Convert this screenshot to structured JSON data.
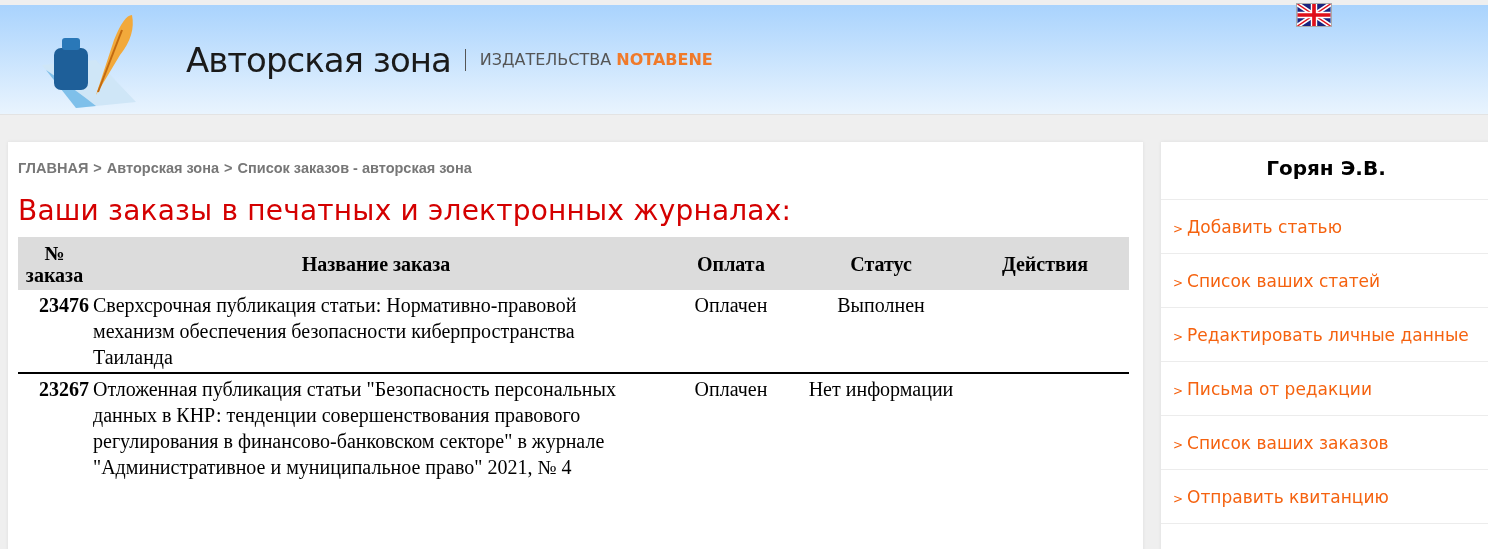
{
  "header": {
    "logo_title": "Авторская зона",
    "logo_subtitle": "ИЗДАТЕЛЬСТВА",
    "logo_brand": "NOTABENE"
  },
  "breadcrumb": [
    {
      "label": "ГЛАВНАЯ"
    },
    {
      "label": "Авторская зона"
    },
    {
      "label": "Список заказов - авторская зона"
    }
  ],
  "breadcrumb_separator": ">",
  "page_title": "Ваши заказы в печатных и электронных журналах:",
  "table": {
    "columns": [
      "№ заказа",
      "Название заказа",
      "Оплата",
      "Статус",
      "Действия"
    ],
    "rows": [
      {
        "number": "23476",
        "title": "Сверхсрочная публикация статьи: Нормативно-правовой механизм обеспечения безопасности киберпространства Таиланда",
        "payment": "Оплачен",
        "status": "Выполнен"
      },
      {
        "number": "23267",
        "title": "Отложенная публикация статьи \"Безопасность персональных данных в КНР: тенденции совершенствования правового регулирования в финансово-банковском секторе\" в журнале \"Административное и муниципальное право\" 2021, № 4",
        "payment": "Оплачен",
        "status": "Нет информации"
      }
    ]
  },
  "sidebar": {
    "user_name": "Горян Э.В.",
    "marker": ">",
    "items": [
      {
        "label": "Добавить статью"
      },
      {
        "label": "Список ваших статей"
      },
      {
        "label": "Редактировать личные данные"
      },
      {
        "label": "Письма от редакции"
      },
      {
        "label": "Список ваших заказов"
      },
      {
        "label": "Отправить квитанцию"
      }
    ]
  }
}
